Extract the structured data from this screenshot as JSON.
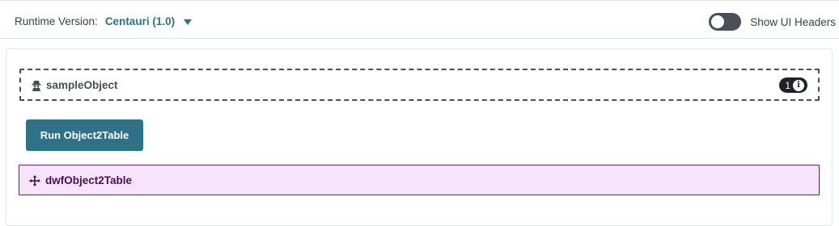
{
  "header": {
    "runtime_label": "Runtime Version:",
    "runtime_value": "Centauri (1.0)",
    "toggle_label": "Show UI Headers",
    "toggle_on": false
  },
  "object_block": {
    "title": "sampleObject",
    "badge_count": "1",
    "icon": "user-secret-icon",
    "badge_icon": "info-icon"
  },
  "run_button": {
    "label": "Run Object2Table"
  },
  "dwf_block": {
    "title": "dwfObject2Table",
    "icon": "move-icon"
  },
  "colors": {
    "accent": "#2f7187",
    "toggle": "#4b5058",
    "dwf_bg": "#f8e3fd",
    "dwf_border": "#6a1e73",
    "badge": "#1f2327"
  }
}
